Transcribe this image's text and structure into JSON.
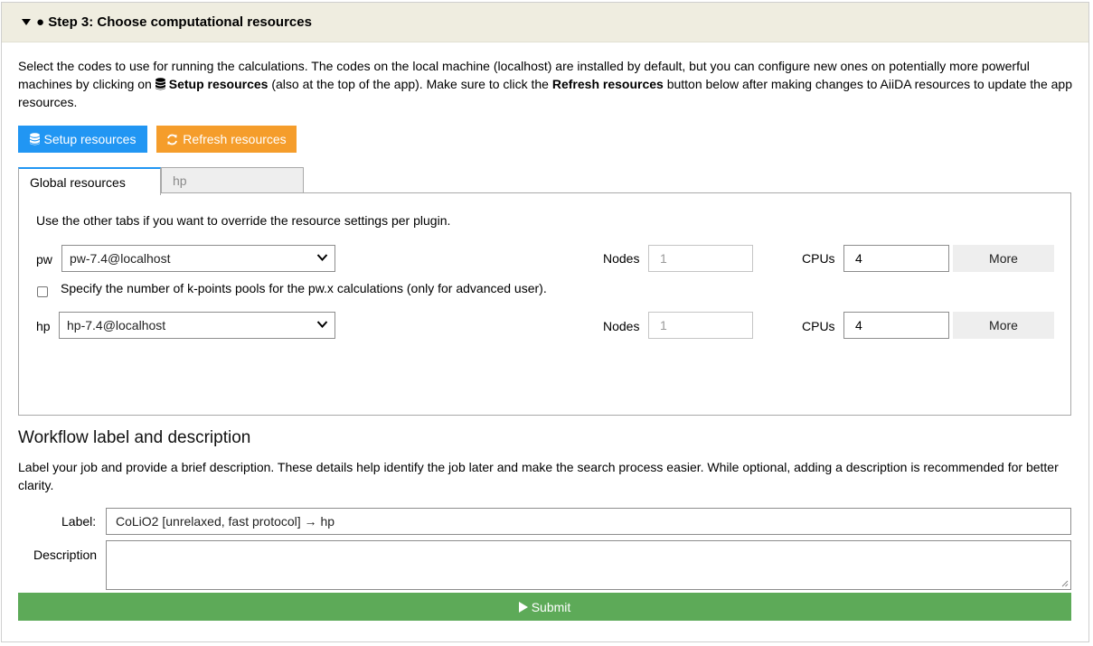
{
  "header": {
    "title": "● Step 3: Choose computational resources"
  },
  "intro": {
    "part1": "Select the codes to use for running the calculations. The codes on the local machine (localhost) are installed by default, but you can configure new ones on potentially more powerful machines by clicking on ",
    "setup_bold": "Setup resources",
    "part2": " (also at the top of the app). Make sure to click the ",
    "refresh_bold": "Refresh resources",
    "part3": " button below after making changes to AiiDA resources to update the app resources."
  },
  "buttons": {
    "setup": "Setup resources",
    "refresh": "Refresh resources"
  },
  "tabs": [
    {
      "label": "Global resources"
    },
    {
      "label": "hp"
    }
  ],
  "panel": {
    "info": "Use the other tabs if you want to override the resource settings per plugin.",
    "codes": [
      {
        "label": "pw",
        "selected": "pw-7.4@localhost",
        "nodes_label": "Nodes",
        "nodes_value": "1",
        "cpus_label": "CPUs",
        "cpus_value": "4",
        "more": "More"
      },
      {
        "label": "hp",
        "selected": "hp-7.4@localhost",
        "nodes_label": "Nodes",
        "nodes_value": "1",
        "cpus_label": "CPUs",
        "cpus_value": "4",
        "more": "More"
      }
    ],
    "kpoints_label": "Specify the number of k-points pools for the pw.x calculations (only for advanced user)."
  },
  "workflow": {
    "title": "Workflow label and description",
    "description": "Label your job and provide a brief description. These details help identify the job later and make the search process easier. While optional, adding a description is recommended for better clarity.",
    "label_caption": "Label:",
    "label_value": "CoLiO2 [unrelaxed, fast protocol] → hp",
    "description_caption": "Description",
    "description_value": ""
  },
  "submit": {
    "label": "Submit"
  },
  "colors": {
    "primary": "#2196f3",
    "warning": "#f59d2b",
    "success": "#5daa58",
    "header_bg": "#efede0"
  }
}
